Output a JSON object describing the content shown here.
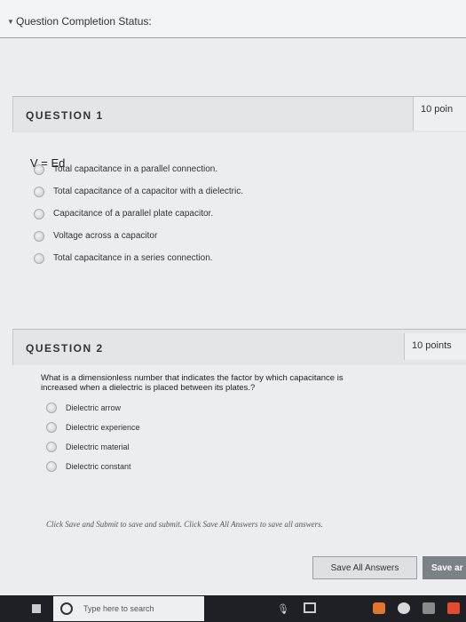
{
  "status_bar": {
    "label": "Question Completion Status:"
  },
  "question1": {
    "title": "QUESTION 1",
    "points": "10 poin",
    "prompt": "V = Ed",
    "options": [
      "Total capacitance in a parallel connection.",
      "Total capacitance of a capacitor with a dielectric.",
      "Capacitance of a parallel plate capacitor.",
      "Voltage across a capacitor",
      "Total capacitance in a series connection."
    ]
  },
  "question2": {
    "title": "QUESTION 2",
    "points": "10 points",
    "prompt_line1": "What is a dimensionless number that indicates the factor by which capacitance is",
    "prompt_line2": "increased when a dielectric is placed between its plates.?",
    "options": [
      "Dielectric arrow",
      "Dielectric experience",
      "Dielectric material",
      "Dielectric constant"
    ]
  },
  "footer": {
    "instructions": "Click Save and Submit to save and submit. Click Save All Answers to save all answers.",
    "save_all_label": "Save All Answers",
    "save_submit_label": "Save ar"
  },
  "taskbar": {
    "search_placeholder": "Type here to search",
    "icons": [
      "windows-icon",
      "cortana-icon",
      "mic-icon",
      "task-view-icon",
      "app-icon-1",
      "app-icon-2",
      "app-icon-3",
      "app-icon-4"
    ]
  },
  "colors": {
    "page_bg": "#ecedef",
    "taskbar_bg": "#1f2024",
    "submit_button": "#7c8087"
  }
}
